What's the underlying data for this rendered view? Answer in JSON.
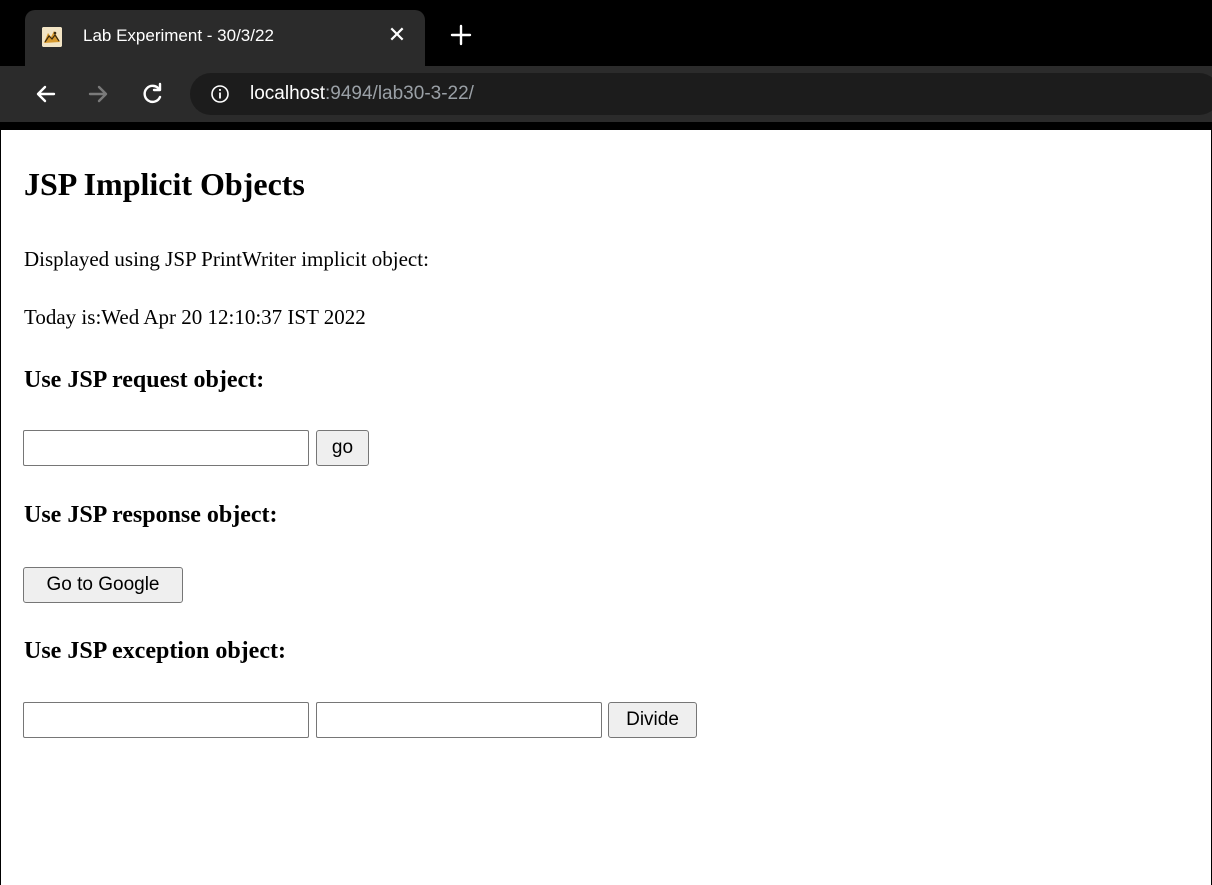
{
  "browser": {
    "tab": {
      "title": "Lab Experiment - 30/3/22",
      "close_glyph": "✕"
    },
    "address": {
      "host": "localhost",
      "rest": ":9494/lab30-3-22/"
    },
    "icons": {
      "favicon": "tomcat-favicon-icon",
      "close": "close-icon",
      "new_tab": "plus-icon",
      "back": "arrow-left-icon",
      "forward": "arrow-right-icon",
      "reload": "reload-icon",
      "site_info": "info-icon"
    },
    "colors": {
      "frame": "#000000",
      "tab_active": "#2b2b2b",
      "omnibox": "#1c1c1c",
      "url_dim": "#9aa0a6"
    }
  },
  "page": {
    "title": "JSP Implicit Objects",
    "printwriter_text": "Displayed using JSP PrintWriter implicit object:",
    "date_text": "Today is:Wed Apr 20 12:10:37 IST 2022",
    "request_section": {
      "heading": "Use JSP request object:",
      "input_value": "",
      "button_label": "go"
    },
    "response_section": {
      "heading": "Use JSP response object:",
      "button_label": "Go to Google"
    },
    "exception_section": {
      "heading": "Use JSP exception object:",
      "input1_value": "",
      "input2_value": "",
      "button_label": "Divide"
    }
  }
}
